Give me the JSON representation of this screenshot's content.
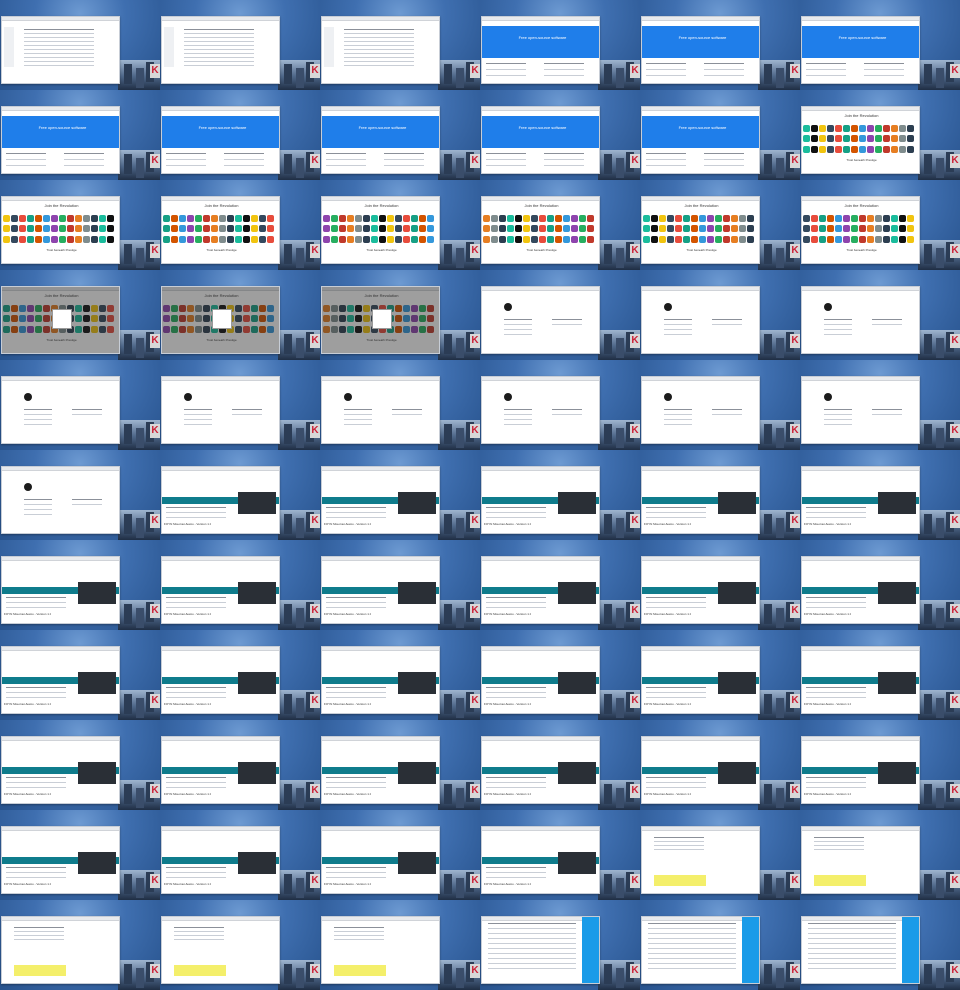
{
  "colors": {
    "desktop": "#2f5f9e",
    "hero_blue": "#1f7eea",
    "teal_bar": "#0f7c8c",
    "highlight_yellow": "#f4ef6b",
    "side_blue": "#1a9be8",
    "k_logo_red": "#cc1f36"
  },
  "screens": {
    "table": {
      "lines": 10
    },
    "hero": {
      "headline": "Free open-source software"
    },
    "logos": {
      "headline": "Join the Revolution",
      "footer": "Trust beneath Prestige"
    },
    "profile": {
      "kind": "profile"
    },
    "teal": {
      "kind": "teal",
      "heading": "ΣΟΥΝ Μειωτικό Δικαιο - Version 1.0"
    },
    "yellow": {
      "kind": "yellow"
    },
    "print": {
      "kind": "print"
    }
  },
  "grid": {
    "columns": 6,
    "rows": [
      [
        "table",
        "table",
        "table",
        "hero",
        "hero",
        "hero"
      ],
      [
        "hero",
        "hero",
        "hero",
        "hero",
        "hero",
        "logos"
      ],
      [
        "logos",
        "logos",
        "logos",
        "logos",
        "logos",
        "logos"
      ],
      [
        "logos-dim",
        "logos-dim",
        "logos-dim",
        "profile",
        "profile",
        "profile"
      ],
      [
        "profile",
        "profile",
        "profile",
        "profile",
        "profile",
        "profile"
      ],
      [
        "profile",
        "teal",
        "teal",
        "teal",
        "teal",
        "teal"
      ],
      [
        "teal",
        "teal",
        "teal",
        "teal",
        "teal",
        "teal"
      ],
      [
        "teal",
        "teal",
        "teal",
        "teal",
        "teal",
        "teal"
      ],
      [
        "teal",
        "teal",
        "teal",
        "teal",
        "teal",
        "teal"
      ],
      [
        "teal",
        "teal",
        "teal",
        "teal",
        "yellow",
        "yellow"
      ],
      [
        "yellow",
        "yellow",
        "yellow",
        "print",
        "print",
        "print"
      ]
    ]
  },
  "logo_palette": [
    "#c0392b",
    "#2c3e50",
    "#f1c40f",
    "#16a085",
    "#8e44ad",
    "#e67e22",
    "#1abc9c",
    "#34495e",
    "#d35400",
    "#27ae60",
    "#7f8c8d",
    "#111111",
    "#e74c3c",
    "#3498db"
  ]
}
